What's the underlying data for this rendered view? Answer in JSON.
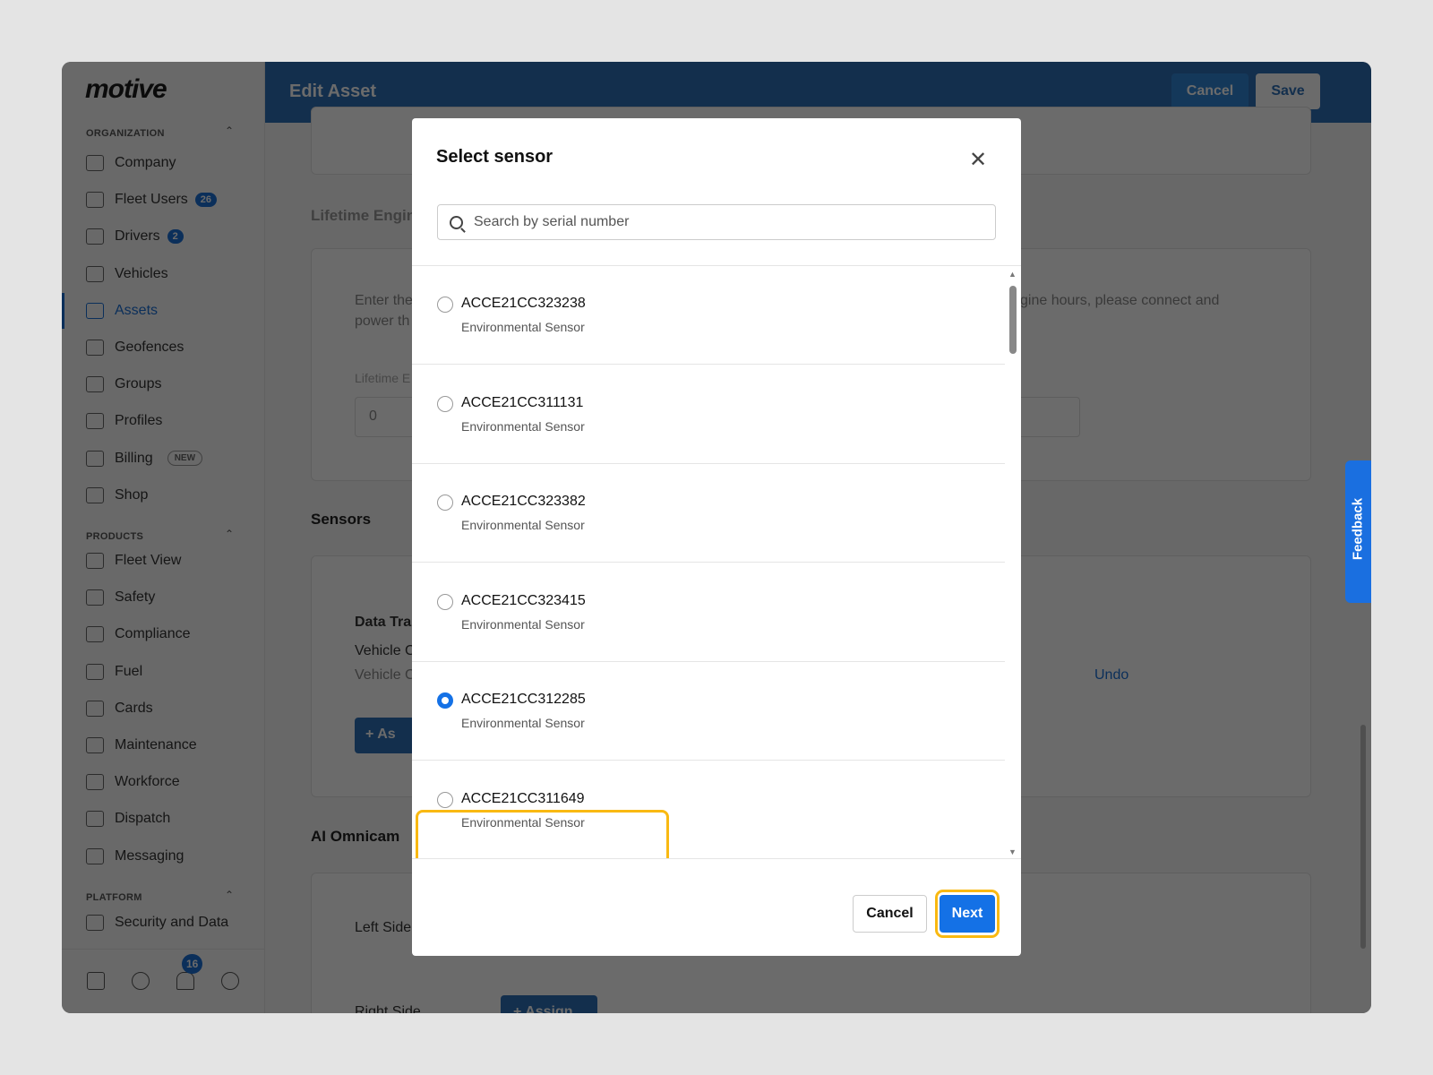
{
  "app": {
    "logo": "motive",
    "page_title": "Edit Asset",
    "cancel": "Cancel",
    "save": "Save"
  },
  "sidebar": {
    "organization": "ORGANIZATION",
    "products": "PRODUCTS",
    "platform": "PLATFORM",
    "org_items": [
      {
        "label": "Company"
      },
      {
        "label": "Fleet Users",
        "badge": "26"
      },
      {
        "label": "Drivers",
        "badge": "2"
      },
      {
        "label": "Vehicles"
      },
      {
        "label": "Assets"
      },
      {
        "label": "Geofences"
      },
      {
        "label": "Groups"
      },
      {
        "label": "Profiles"
      },
      {
        "label": "Billing",
        "tag": "NEW"
      },
      {
        "label": "Shop"
      }
    ],
    "product_items": [
      {
        "label": "Fleet View"
      },
      {
        "label": "Safety"
      },
      {
        "label": "Compliance"
      },
      {
        "label": "Fuel"
      },
      {
        "label": "Cards"
      },
      {
        "label": "Maintenance"
      },
      {
        "label": "Workforce"
      },
      {
        "label": "Dispatch"
      },
      {
        "label": "Messaging"
      }
    ],
    "platform_items": [
      {
        "label": "Security and Data"
      }
    ],
    "notifications_count": "16"
  },
  "background": {
    "lifetime_title": "Lifetime Engin",
    "enter_text_1": "Enter the",
    "enter_text_2": "power th",
    "enter_text_right": "gine hours, please connect and",
    "lifetime_label": "Lifetime E",
    "lifetime_value": "0",
    "sensors_title": "Sensors",
    "data_tra": "Data Tra",
    "vehicle_1": "Vehicle C",
    "vehicle_2": "Vehicle C",
    "undo": "Undo",
    "assign_partial": "As",
    "omnicam_title": "AI Omnicam",
    "left_side": "Left Side",
    "right_side": "Right Side",
    "assign": "Assign"
  },
  "modal": {
    "title": "Select sensor",
    "search_placeholder": "Search by serial number",
    "sensors": [
      {
        "serial": "ACCE21CC323238",
        "type": "Environmental Sensor",
        "selected": false
      },
      {
        "serial": "ACCE21CC311131",
        "type": "Environmental Sensor",
        "selected": false
      },
      {
        "serial": "ACCE21CC323382",
        "type": "Environmental Sensor",
        "selected": false
      },
      {
        "serial": "ACCE21CC323415",
        "type": "Environmental Sensor",
        "selected": false
      },
      {
        "serial": "ACCE21CC312285",
        "type": "Environmental Sensor",
        "selected": true
      },
      {
        "serial": "ACCE21CC311649",
        "type": "Environmental Sensor",
        "selected": false
      }
    ],
    "cancel": "Cancel",
    "next": "Next"
  },
  "feedback": "Feedback",
  "colors": {
    "primary": "#1471e6",
    "highlight": "#f9b912",
    "header": "#2d6fb7"
  }
}
